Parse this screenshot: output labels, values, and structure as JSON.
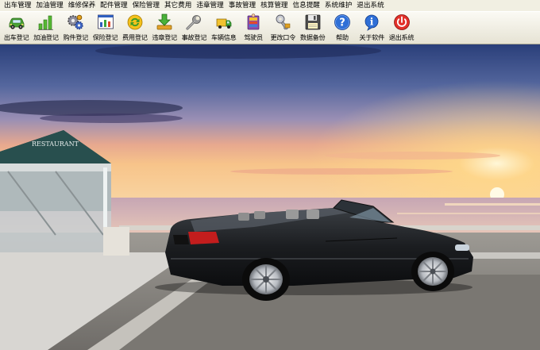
{
  "menu": {
    "items": [
      {
        "id": "depart",
        "label": "出车管理"
      },
      {
        "id": "fuel",
        "label": "加油管理"
      },
      {
        "id": "repair",
        "label": "维修保养"
      },
      {
        "id": "parts",
        "label": "配件管理"
      },
      {
        "id": "insurance",
        "label": "保险管理"
      },
      {
        "id": "other",
        "label": "其它费用"
      },
      {
        "id": "violation",
        "label": "违章管理"
      },
      {
        "id": "accident",
        "label": "事故管理"
      },
      {
        "id": "audit",
        "label": "核算管理"
      },
      {
        "id": "reminder",
        "label": "信息提醒"
      },
      {
        "id": "maintenance",
        "label": "系统维护"
      },
      {
        "id": "exit",
        "label": "退出系统"
      }
    ]
  },
  "toolbar": {
    "items": [
      {
        "id": "depart-register",
        "label": "出车登记",
        "icon": "car-icon"
      },
      {
        "id": "fuel-register",
        "label": "加油登记",
        "icon": "bar-chart-icon"
      },
      {
        "id": "parts-register",
        "label": "购件登记",
        "icon": "gears-icon"
      },
      {
        "id": "insurance-register",
        "label": "保险登记",
        "icon": "chart-board-icon"
      },
      {
        "id": "expense-register",
        "label": "费用登记",
        "icon": "refresh-arrows-icon"
      },
      {
        "id": "violation-register",
        "label": "违章登记",
        "icon": "download-arrow-icon"
      },
      {
        "id": "accident-register",
        "label": "事故登记",
        "icon": "wrench-icon"
      },
      {
        "id": "vehicle-info",
        "label": "车辆信息",
        "icon": "vehicle-info-icon"
      },
      {
        "id": "driver",
        "label": "驾驶员",
        "icon": "people-icon"
      },
      {
        "id": "change-password",
        "label": "更改口令",
        "icon": "key-icon"
      },
      {
        "id": "backup",
        "label": "数据备份",
        "icon": "floppy-disk-icon"
      },
      {
        "id": "help",
        "label": "帮助",
        "icon": "help-icon"
      },
      {
        "id": "about",
        "label": "关于软件",
        "icon": "info-icon"
      },
      {
        "id": "exit-system",
        "label": "退出系统",
        "icon": "power-icon"
      }
    ]
  },
  "colors": {
    "menubar": "#f1efe2",
    "toolbar": "#ece9d8"
  }
}
